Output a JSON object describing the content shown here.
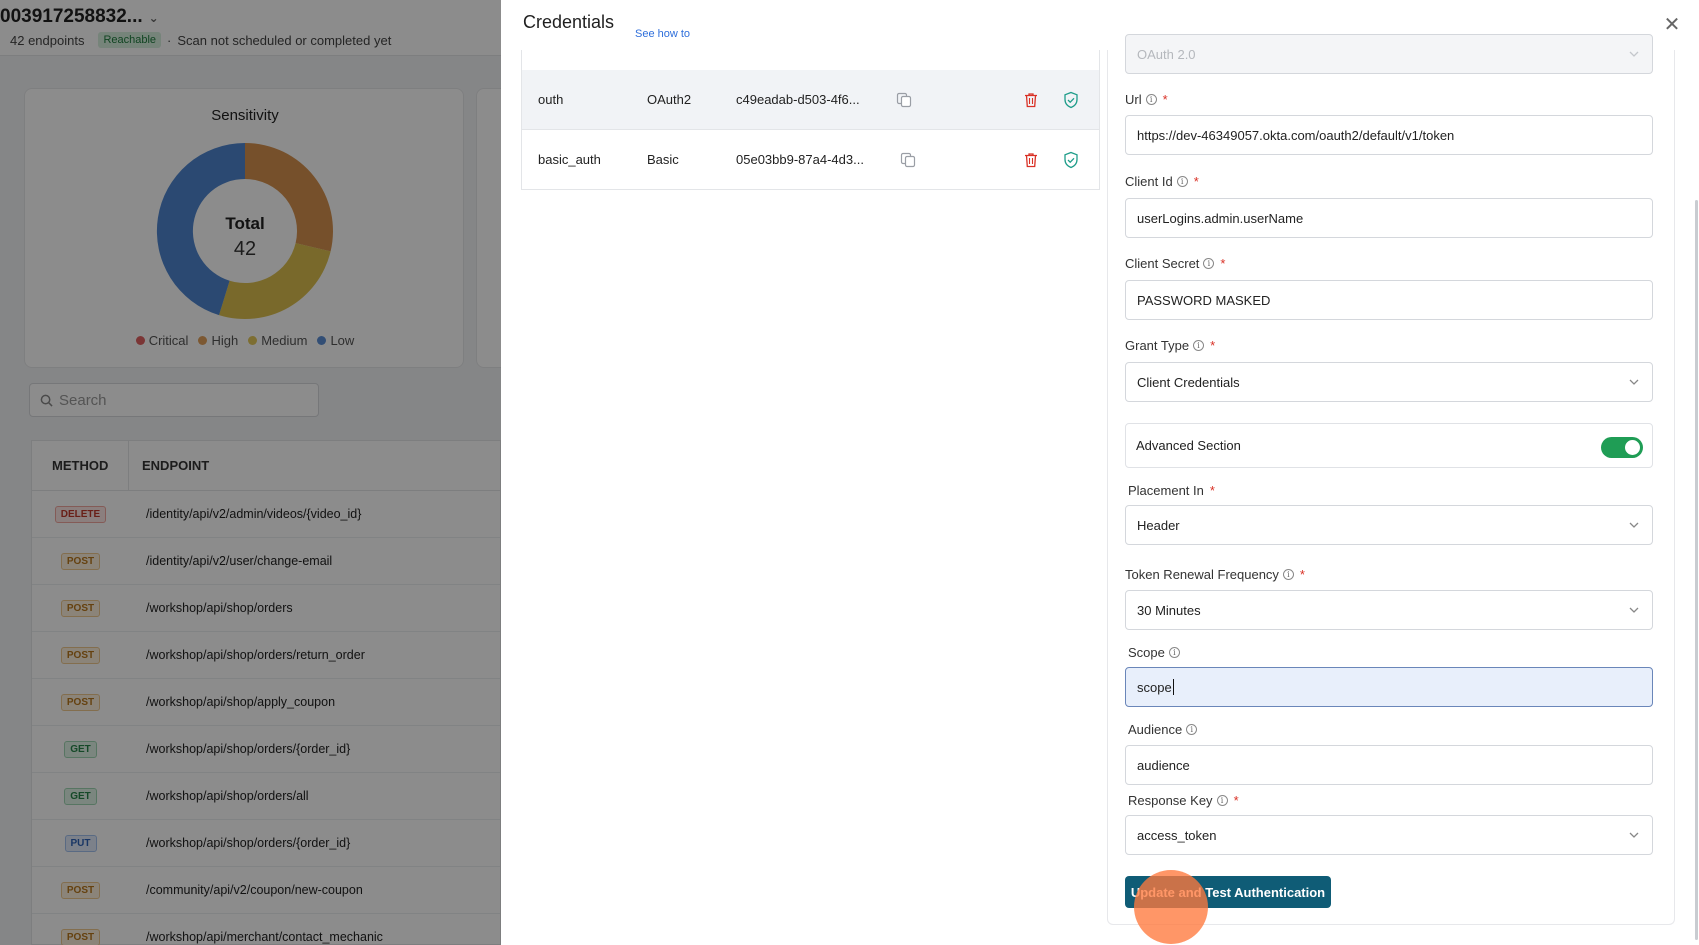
{
  "background": {
    "title": "003917258832...",
    "endpoints_text": "42 endpoints",
    "reachable_badge": "Reachable",
    "scan_status": "Scan not scheduled or completed yet",
    "sensitivity": {
      "title": "Sensitivity",
      "total_label": "Total",
      "total_value": "42",
      "legend": [
        {
          "label": "Critical",
          "color": "#e06262"
        },
        {
          "label": "High",
          "color": "#e2a15b"
        },
        {
          "label": "Medium",
          "color": "#e4c95b"
        },
        {
          "label": "Low",
          "color": "#5b8fd6"
        }
      ]
    },
    "search_placeholder": "Search",
    "table": {
      "headers": {
        "method": "METHOD",
        "endpoint": "ENDPOINT"
      },
      "rows": [
        {
          "method": "DELETE",
          "endpoint": "/identity/api/v2/admin/videos/{video_id}"
        },
        {
          "method": "POST",
          "endpoint": "/identity/api/v2/user/change-email"
        },
        {
          "method": "POST",
          "endpoint": "/workshop/api/shop/orders"
        },
        {
          "method": "POST",
          "endpoint": "/workshop/api/shop/orders/return_order"
        },
        {
          "method": "POST",
          "endpoint": "/workshop/api/shop/apply_coupon"
        },
        {
          "method": "GET",
          "endpoint": "/workshop/api/shop/orders/{order_id}"
        },
        {
          "method": "GET",
          "endpoint": "/workshop/api/shop/orders/all"
        },
        {
          "method": "PUT",
          "endpoint": "/workshop/api/shop/orders/{order_id}"
        },
        {
          "method": "POST",
          "endpoint": "/community/api/v2/coupon/new-coupon"
        },
        {
          "method": "POST",
          "endpoint": "/workshop/api/merchant/contact_mechanic"
        }
      ]
    }
  },
  "drawer": {
    "title": "Credentials",
    "see_how": "See how to",
    "credentials": [
      {
        "name": "outh",
        "type": "OAuth2",
        "id": "c49eadab-d503-4f6..."
      },
      {
        "name": "basic_auth",
        "type": "Basic",
        "id": "05e03bb9-87a4-4d3..."
      }
    ],
    "form": {
      "auth_type_value": "OAuth 2.0",
      "url_label": "Url",
      "url_value": "https://dev-46349057.okta.com/oauth2/default/v1/token",
      "client_id_label": "Client Id",
      "client_id_value": "userLogins.admin.userName",
      "client_secret_label": "Client Secret",
      "client_secret_value": "PASSWORD MASKED",
      "grant_type_label": "Grant Type",
      "grant_type_value": "Client Credentials",
      "advanced_label": "Advanced Section",
      "placement_label": "Placement In",
      "placement_value": "Header",
      "renewal_label": "Token Renewal Frequency",
      "renewal_value": "30 Minutes",
      "scope_label": "Scope",
      "scope_value": "scope",
      "audience_label": "Audience",
      "audience_value": "audience",
      "response_key_label": "Response Key",
      "response_key_value": "access_token",
      "submit_label": "Update and Test Authentication"
    }
  }
}
